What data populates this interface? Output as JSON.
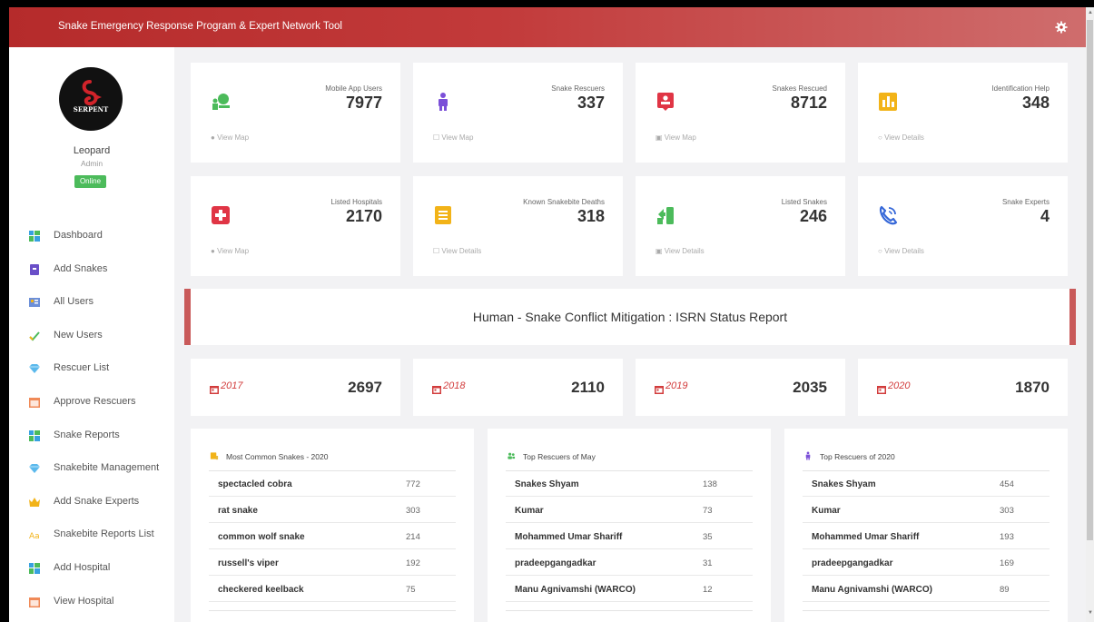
{
  "header": {
    "title": "Snake Emergency Response Program & Expert Network Tool"
  },
  "user": {
    "logo_text": "SERPENT",
    "name": "Leopard",
    "role": "Admin",
    "status": "Online"
  },
  "sidebar": {
    "items": [
      {
        "label": "Dashboard",
        "icon": "dashboard-icon"
      },
      {
        "label": "Add Snakes",
        "icon": "add-snakes-icon"
      },
      {
        "label": "All Users",
        "icon": "users-icon"
      },
      {
        "label": "New Users",
        "icon": "check-icon"
      },
      {
        "label": "Rescuer List",
        "icon": "diamond-icon"
      },
      {
        "label": "Approve Rescuers",
        "icon": "calendar-icon"
      },
      {
        "label": "Snake Reports",
        "icon": "dashboard-icon"
      },
      {
        "label": "Snakebite Management",
        "icon": "diamond-icon"
      },
      {
        "label": "Add Snake Experts",
        "icon": "crown-icon"
      },
      {
        "label": "Snakebite Reports List",
        "icon": "text-icon"
      },
      {
        "label": "Add Hospital",
        "icon": "dashboard-icon"
      },
      {
        "label": "View Hospital",
        "icon": "calendar-icon"
      }
    ]
  },
  "stats": [
    {
      "label": "Mobile App Users",
      "value": "7977",
      "link": "View Map",
      "icon": "mobile-users-icon",
      "color": "#4cbb5b"
    },
    {
      "label": "Snake Rescuers",
      "value": "337",
      "link": "View Map",
      "icon": "person-icon",
      "color": "#7b4fd8"
    },
    {
      "label": "Snakes Rescued",
      "value": "8712",
      "link": "View Map",
      "icon": "badge-icon",
      "color": "#e03545"
    },
    {
      "label": "Identification Help",
      "value": "348",
      "link": "View Details",
      "icon": "bar-chart-icon",
      "color": "#f2b318"
    },
    {
      "label": "Listed Hospitals",
      "value": "2170",
      "link": "View Map",
      "icon": "hospital-icon",
      "color": "#e03545"
    },
    {
      "label": "Known Snakebite Deaths",
      "value": "318",
      "link": "View Details",
      "icon": "document-icon",
      "color": "#f2b318"
    },
    {
      "label": "Listed Snakes",
      "value": "246",
      "link": "View Details",
      "icon": "refresh-phone-icon",
      "color": "#4cbb5b"
    },
    {
      "label": "Snake Experts",
      "value": "4",
      "link": "View Details",
      "icon": "phone-icon",
      "color": "#3567d8"
    }
  ],
  "banner": {
    "title": "Human - Snake Conflict Mitigation : ISRN Status Report"
  },
  "years": [
    {
      "label": "2017",
      "value": "2697"
    },
    {
      "label": "2018",
      "value": "2110"
    },
    {
      "label": "2019",
      "value": "2035"
    },
    {
      "label": "2020",
      "value": "1870"
    }
  ],
  "panels": [
    {
      "title": "Most Common Snakes - 2020",
      "icon": "folder-icon",
      "icon_color": "#f2b318",
      "rows": [
        [
          "spectacled cobra",
          "772"
        ],
        [
          "rat snake",
          "303"
        ],
        [
          "common wolf snake",
          "214"
        ],
        [
          "russell's viper",
          "192"
        ],
        [
          "checkered keelback",
          "75"
        ]
      ]
    },
    {
      "title": "Top Rescuers of May",
      "icon": "users-icon",
      "icon_color": "#4cbb5b",
      "rows": [
        [
          "Snakes Shyam",
          "138"
        ],
        [
          "Kumar",
          "73"
        ],
        [
          "Mohammed Umar Shariff",
          "35"
        ],
        [
          "pradeepgangadkar",
          "31"
        ],
        [
          "Manu Agnivamshi (WARCO)",
          "12"
        ]
      ]
    },
    {
      "title": "Top Rescuers of 2020",
      "icon": "person-icon",
      "icon_color": "#7b4fd8",
      "rows": [
        [
          "Snakes Shyam",
          "454"
        ],
        [
          "Kumar",
          "303"
        ],
        [
          "Mohammed Umar Shariff",
          "193"
        ],
        [
          "pradeepgangadkar",
          "169"
        ],
        [
          "Manu Agnivamshi (WARCO)",
          "89"
        ]
      ]
    }
  ],
  "colors": {
    "accent": "#b52b2b",
    "online": "#4cbb5b",
    "year_text": "#d23c3c"
  }
}
